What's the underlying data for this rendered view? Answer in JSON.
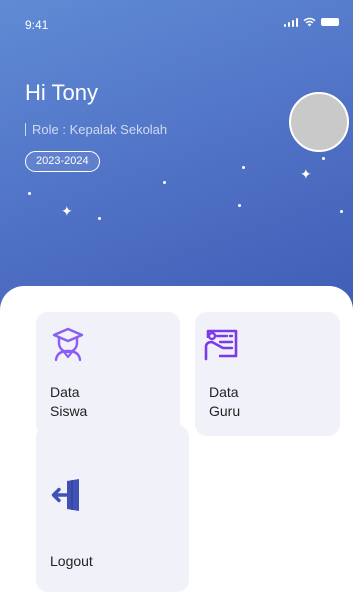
{
  "status_bar": {
    "time": "9:41",
    "icons": [
      "signal-icon",
      "wifi-icon",
      "battery-icon"
    ]
  },
  "profile": {
    "greeting": "Hi Tony",
    "role": "Role : Kepalak Sekolah",
    "year": "2023-2024"
  },
  "menu": {
    "data_siswa": {
      "line1": "Data",
      "line2": "Siswa",
      "icon": "student-icon"
    },
    "data_guru": {
      "line1": "Data",
      "line2": "Guru",
      "icon": "teacher-icon"
    },
    "logout": {
      "label": "Logout",
      "icon": "logout-icon"
    }
  },
  "colors": {
    "header_gradient_start": "#5f8bd4",
    "header_gradient_end": "#3f5cb5",
    "accent_purple": "#8b5cf6",
    "accent_blue": "#3f51b5",
    "card_bg": "#f1f2f9"
  }
}
